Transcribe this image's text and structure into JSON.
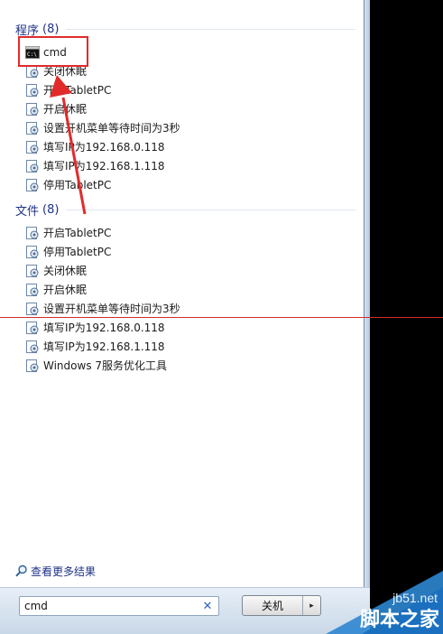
{
  "programs": {
    "title": "程序",
    "count": "(8)",
    "items": [
      {
        "label": "cmd",
        "icon": "cmd-icon"
      },
      {
        "label": "关闭休眠",
        "icon": "script-icon"
      },
      {
        "label": "开启TabletPC",
        "icon": "script-icon"
      },
      {
        "label": "开启休眠",
        "icon": "script-icon"
      },
      {
        "label": "设置开机菜单等待时间为3秒",
        "icon": "script-icon"
      },
      {
        "label": "填写IP为192.168.0.118",
        "icon": "script-icon"
      },
      {
        "label": "填写IP为192.168.1.118",
        "icon": "script-icon"
      },
      {
        "label": "停用TabletPC",
        "icon": "script-icon"
      }
    ]
  },
  "files": {
    "title": "文件",
    "count": "(8)",
    "items": [
      {
        "label": "开启TabletPC",
        "icon": "script-icon"
      },
      {
        "label": "停用TabletPC",
        "icon": "script-icon"
      },
      {
        "label": "关闭休眠",
        "icon": "script-icon"
      },
      {
        "label": "开启休眠",
        "icon": "script-icon"
      },
      {
        "label": "设置开机菜单等待时间为3秒",
        "icon": "script-icon"
      },
      {
        "label": "填写IP为192.168.0.118",
        "icon": "script-icon"
      },
      {
        "label": "填写IP为192.168.1.118",
        "icon": "script-icon"
      },
      {
        "label": "Windows 7服务优化工具",
        "icon": "script-icon"
      }
    ]
  },
  "see_more": {
    "label": "查看更多结果",
    "icon": "magnifier-icon"
  },
  "search": {
    "value": "cmd",
    "clear_icon": "close-icon"
  },
  "shutdown": {
    "label": "关机",
    "arrow": "▸"
  },
  "watermark": {
    "site": "jb51.net",
    "brand": "脚本之家"
  },
  "colors": {
    "header": "#1e3287",
    "annotation_red": "#e12b2b",
    "background": "#000000"
  }
}
